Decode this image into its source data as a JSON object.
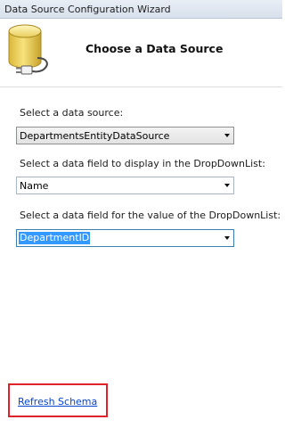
{
  "window": {
    "title": "Data Source Configuration Wizard"
  },
  "header": {
    "heading": "Choose a Data Source",
    "icon": "database-plug-icon"
  },
  "form": {
    "data_source_label": "Select a data source:",
    "data_source_value": "DepartmentsEntityDataSource",
    "display_field_label": "Select a data field to display in the DropDownList:",
    "display_field_value": "Name",
    "value_field_label": "Select a data field for the value of the DropDownList:",
    "value_field_value": "DepartmentID"
  },
  "footer": {
    "refresh_link": "Refresh Schema"
  },
  "colors": {
    "highlight_box": "#e0222b",
    "link": "#0645cc",
    "selection": "#3399ff"
  }
}
